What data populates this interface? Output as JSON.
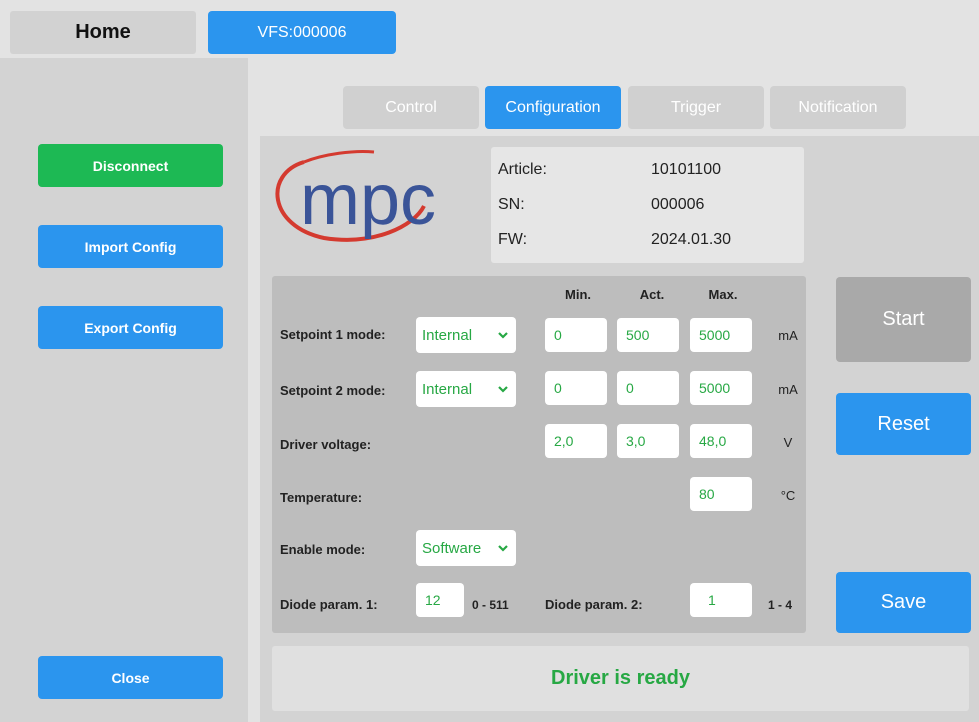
{
  "header": {
    "home_label": "Home",
    "device_tab_label": "VFS:000006"
  },
  "sidebar": {
    "disconnect_label": "Disconnect",
    "import_label": "Import Config",
    "export_label": "Export Config",
    "close_label": "Close"
  },
  "tabs": {
    "control": "Control",
    "configuration": "Configuration",
    "trigger": "Trigger",
    "notification": "Notification",
    "active": "Configuration"
  },
  "logo": {
    "text": "mpc"
  },
  "info": {
    "article_label": "Article:",
    "article_value": "10101100",
    "sn_label": "SN:",
    "sn_value": "000006",
    "fw_label": "FW:",
    "fw_value": "2024.01.30"
  },
  "config": {
    "headers": {
      "min": "Min.",
      "act": "Act.",
      "max": "Max."
    },
    "setpoint1": {
      "label": "Setpoint 1 mode:",
      "mode": "Internal",
      "min": "0",
      "act": "500",
      "max": "5000",
      "unit": "mA"
    },
    "setpoint2": {
      "label": "Setpoint 2 mode:",
      "mode": "Internal",
      "min": "0",
      "act": "0",
      "max": "5000",
      "unit": "mA"
    },
    "driver_voltage": {
      "label": "Driver voltage:",
      "min": "2,0",
      "act": "3,0",
      "max": "48,0",
      "unit": "V"
    },
    "temperature": {
      "label": "Temperature:",
      "max": "80",
      "unit": "°C"
    },
    "enable_mode": {
      "label": "Enable mode:",
      "value": "Software"
    },
    "diode1": {
      "label": "Diode param. 1:",
      "value": "12",
      "range": "0 - 511"
    },
    "diode2": {
      "label": "Diode param. 2:",
      "value": "1",
      "range": "1 - 4"
    }
  },
  "actions": {
    "start_label": "Start",
    "reset_label": "Reset",
    "save_label": "Save"
  },
  "status": {
    "text": "Driver is ready"
  },
  "colors": {
    "accent_blue": "#2b95ee",
    "success_green": "#1db954",
    "value_green": "#27a844",
    "disabled_gray": "#a9a9a9",
    "logo_blue": "#3a5498",
    "logo_red": "#d43a2f"
  }
}
